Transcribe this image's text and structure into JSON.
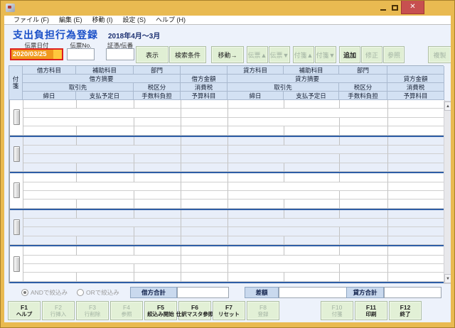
{
  "window": {
    "controls": {
      "minimize": "minimize",
      "maximize": "maximize",
      "close": "close"
    }
  },
  "menu": {
    "items": [
      {
        "label": "ファイル (F)"
      },
      {
        "label": "編集 (E)"
      },
      {
        "label": "移動 (I)"
      },
      {
        "label": "設定 (S)"
      },
      {
        "label": "ヘルプ (H)"
      }
    ]
  },
  "header": {
    "title": "支出負担行為登録",
    "period": "2018年4月～3月"
  },
  "toolbar": {
    "fields": [
      {
        "label": "伝票日付",
        "value": "2020/03/25",
        "state": "active"
      },
      {
        "label": "伝票No.",
        "value": "",
        "state": "normal"
      },
      {
        "label": "証憑/伝番",
        "value": "",
        "state": "normal"
      }
    ],
    "show_button": {
      "label": "表示",
      "enabled": true
    },
    "search_button": {
      "label": "検索条件",
      "enabled": true
    },
    "move_button": {
      "label": "移動→",
      "enabled": true
    },
    "slip_up_button": {
      "label": "伝票▲",
      "enabled": false
    },
    "slip_down_button": {
      "label": "伝票▼",
      "enabled": false
    },
    "fusen_up_button": {
      "label": "付箋▲",
      "enabled": false
    },
    "fusen_down_button": {
      "label": "付箋▼",
      "enabled": false
    },
    "add_button": {
      "label": "追加",
      "enabled": true
    },
    "modify_button": {
      "label": "修正",
      "enabled": false
    },
    "reference_button": {
      "label": "参照",
      "enabled": false
    },
    "duplicate_button": {
      "label": "複製",
      "enabled": false
    }
  },
  "grid": {
    "fusen_label": "付箋",
    "row_count": 5,
    "header_rows": [
      {
        "debit": [
          {
            "label": "借方科目",
            "span": 1
          },
          {
            "label": "補助科目",
            "span": 1
          },
          {
            "label": "部門",
            "span": 1
          },
          {
            "label": "",
            "span": 1
          }
        ],
        "credit": [
          {
            "label": "貸方科目",
            "span": 1
          },
          {
            "label": "補助科目",
            "span": 1
          },
          {
            "label": "部門",
            "span": 1
          },
          {
            "label": "",
            "span": 1
          }
        ]
      },
      {
        "debit": [
          {
            "label": "借方摘要",
            "span": 3
          },
          {
            "label": "借方金額",
            "span": 1
          }
        ],
        "credit": [
          {
            "label": "貸方摘要",
            "span": 3
          },
          {
            "label": "貸方金額",
            "span": 1
          }
        ]
      },
      {
        "debit": [
          {
            "label": "取引先",
            "span": 2
          },
          {
            "label": "税区分",
            "span": 1
          },
          {
            "label": "消費税",
            "span": 1
          }
        ],
        "credit": [
          {
            "label": "取引先",
            "span": 2
          },
          {
            "label": "税区分",
            "span": 1
          },
          {
            "label": "消費税",
            "span": 1
          }
        ]
      },
      {
        "debit": [
          {
            "label": "締日",
            "span": 1
          },
          {
            "label": "支払予定日",
            "span": 1
          },
          {
            "label": "手数料負担",
            "span": 1
          },
          {
            "label": "予算科目",
            "span": 1
          }
        ],
        "credit": [
          {
            "label": "締日",
            "span": 1
          },
          {
            "label": "支払予定日",
            "span": 1
          },
          {
            "label": "手数料負担",
            "span": 1
          },
          {
            "label": "予算科目",
            "span": 1
          }
        ]
      }
    ]
  },
  "totals": {
    "filter_and_label": "ANDで絞込み",
    "filter_or_label": "ORで絞込み",
    "filter_selected": "AND",
    "debit_total_label": "借方合計",
    "debit_total_value": "",
    "difference_label": "差額",
    "difference_value": "",
    "credit_total_label": "貸方合計",
    "credit_total_value": ""
  },
  "function_keys": {
    "left": [
      {
        "key": "F1",
        "label": "ヘルプ",
        "enabled": true
      },
      {
        "key": "F2",
        "label": "行挿入",
        "enabled": false
      },
      {
        "key": "F3",
        "label": "行削除",
        "enabled": false
      },
      {
        "key": "F4",
        "label": "参照",
        "enabled": false
      },
      {
        "key": "F5",
        "label": "絞込み開始",
        "enabled": true
      },
      {
        "key": "F6",
        "label": "仕訳マスタ参照",
        "enabled": true
      },
      {
        "key": "F7",
        "label": "リセット",
        "enabled": true
      },
      {
        "key": "F8",
        "label": "登録",
        "enabled": false
      }
    ],
    "right": [
      {
        "key": "F10",
        "label": "付箋",
        "enabled": false
      },
      {
        "key": "F11",
        "label": "印刷",
        "enabled": true
      },
      {
        "key": "F12",
        "label": "終了",
        "enabled": true
      }
    ]
  }
}
